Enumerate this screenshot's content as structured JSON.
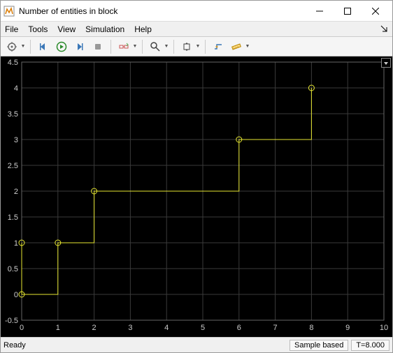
{
  "window": {
    "title": "Number of entities in block"
  },
  "menus": {
    "file": "File",
    "tools": "Tools",
    "view": "View",
    "simulation": "Simulation",
    "help": "Help"
  },
  "status": {
    "ready": "Ready",
    "mode": "Sample based",
    "time": "T=8.000"
  },
  "chart_data": {
    "type": "step",
    "xlim": [
      0,
      10
    ],
    "ylim": [
      -0.5,
      4.5
    ],
    "xticks": [
      0,
      1,
      2,
      3,
      4,
      5,
      6,
      7,
      8,
      9,
      10
    ],
    "yticks": [
      -0.5,
      0,
      0.5,
      1,
      1.5,
      2,
      2.5,
      3,
      3.5,
      4,
      4.5
    ],
    "color": "#e6e632",
    "markers": [
      {
        "x": 0,
        "y": 0
      },
      {
        "x": 0,
        "y": 1
      },
      {
        "x": 1,
        "y": 1
      },
      {
        "x": 2,
        "y": 2
      },
      {
        "x": 6,
        "y": 3
      },
      {
        "x": 8,
        "y": 4
      }
    ],
    "step_segments": [
      {
        "from": [
          0,
          1
        ],
        "to": [
          0,
          0
        ]
      },
      {
        "from": [
          0,
          0
        ],
        "to": [
          1,
          0
        ]
      },
      {
        "from": [
          1,
          0
        ],
        "to": [
          1,
          1
        ]
      },
      {
        "from": [
          1,
          1
        ],
        "to": [
          2,
          1
        ]
      },
      {
        "from": [
          2,
          1
        ],
        "to": [
          2,
          2
        ]
      },
      {
        "from": [
          2,
          2
        ],
        "to": [
          6,
          2
        ]
      },
      {
        "from": [
          6,
          2
        ],
        "to": [
          6,
          3
        ]
      },
      {
        "from": [
          6,
          3
        ],
        "to": [
          8,
          3
        ]
      },
      {
        "from": [
          8,
          3
        ],
        "to": [
          8,
          4
        ]
      }
    ]
  }
}
